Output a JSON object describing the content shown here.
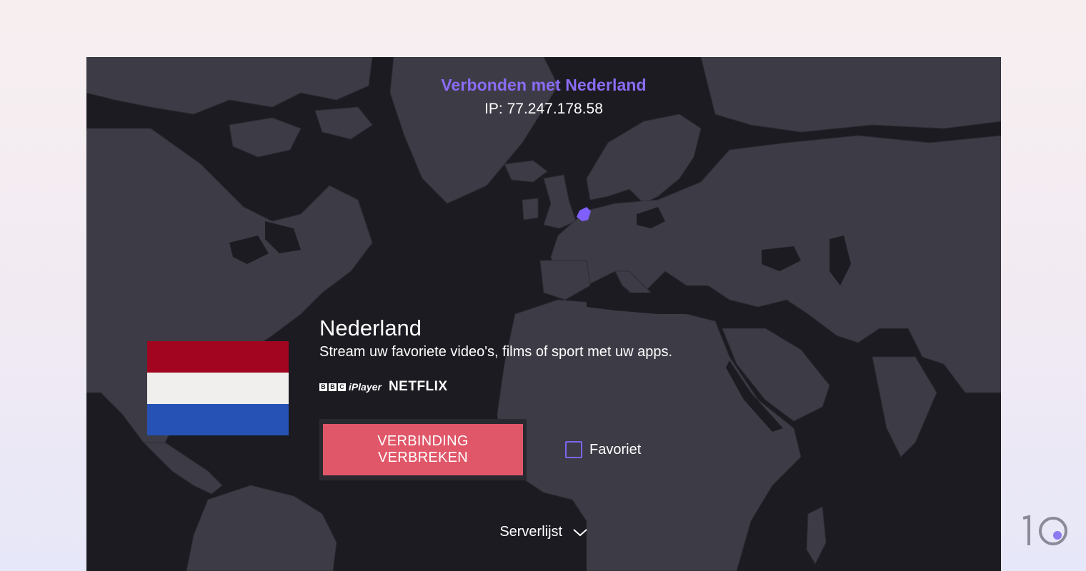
{
  "status": {
    "connected_title": "Verbonden met Nederland",
    "ip": "IP: 77.247.178.58"
  },
  "server": {
    "country": "Nederland",
    "description": "Stream uw favoriete video's, films of sport met uw apps.",
    "flag_colors": [
      "#a1051f",
      "#f0efed",
      "#2552b4"
    ],
    "services": {
      "bbc_letters": [
        "B",
        "B",
        "C"
      ],
      "iplayer": "iPlayer",
      "netflix": "NETFLIX"
    }
  },
  "actions": {
    "disconnect_label": "VERBINDING VERBREKEN",
    "favorite_label": "Favoriet",
    "favorite_checked": false
  },
  "footer": {
    "server_list_label": "Serverlijst"
  },
  "colors": {
    "accent": "#8b6cf6",
    "disconnect": "#e05769",
    "background": "#1c1b21",
    "land": "#3d3c46"
  }
}
